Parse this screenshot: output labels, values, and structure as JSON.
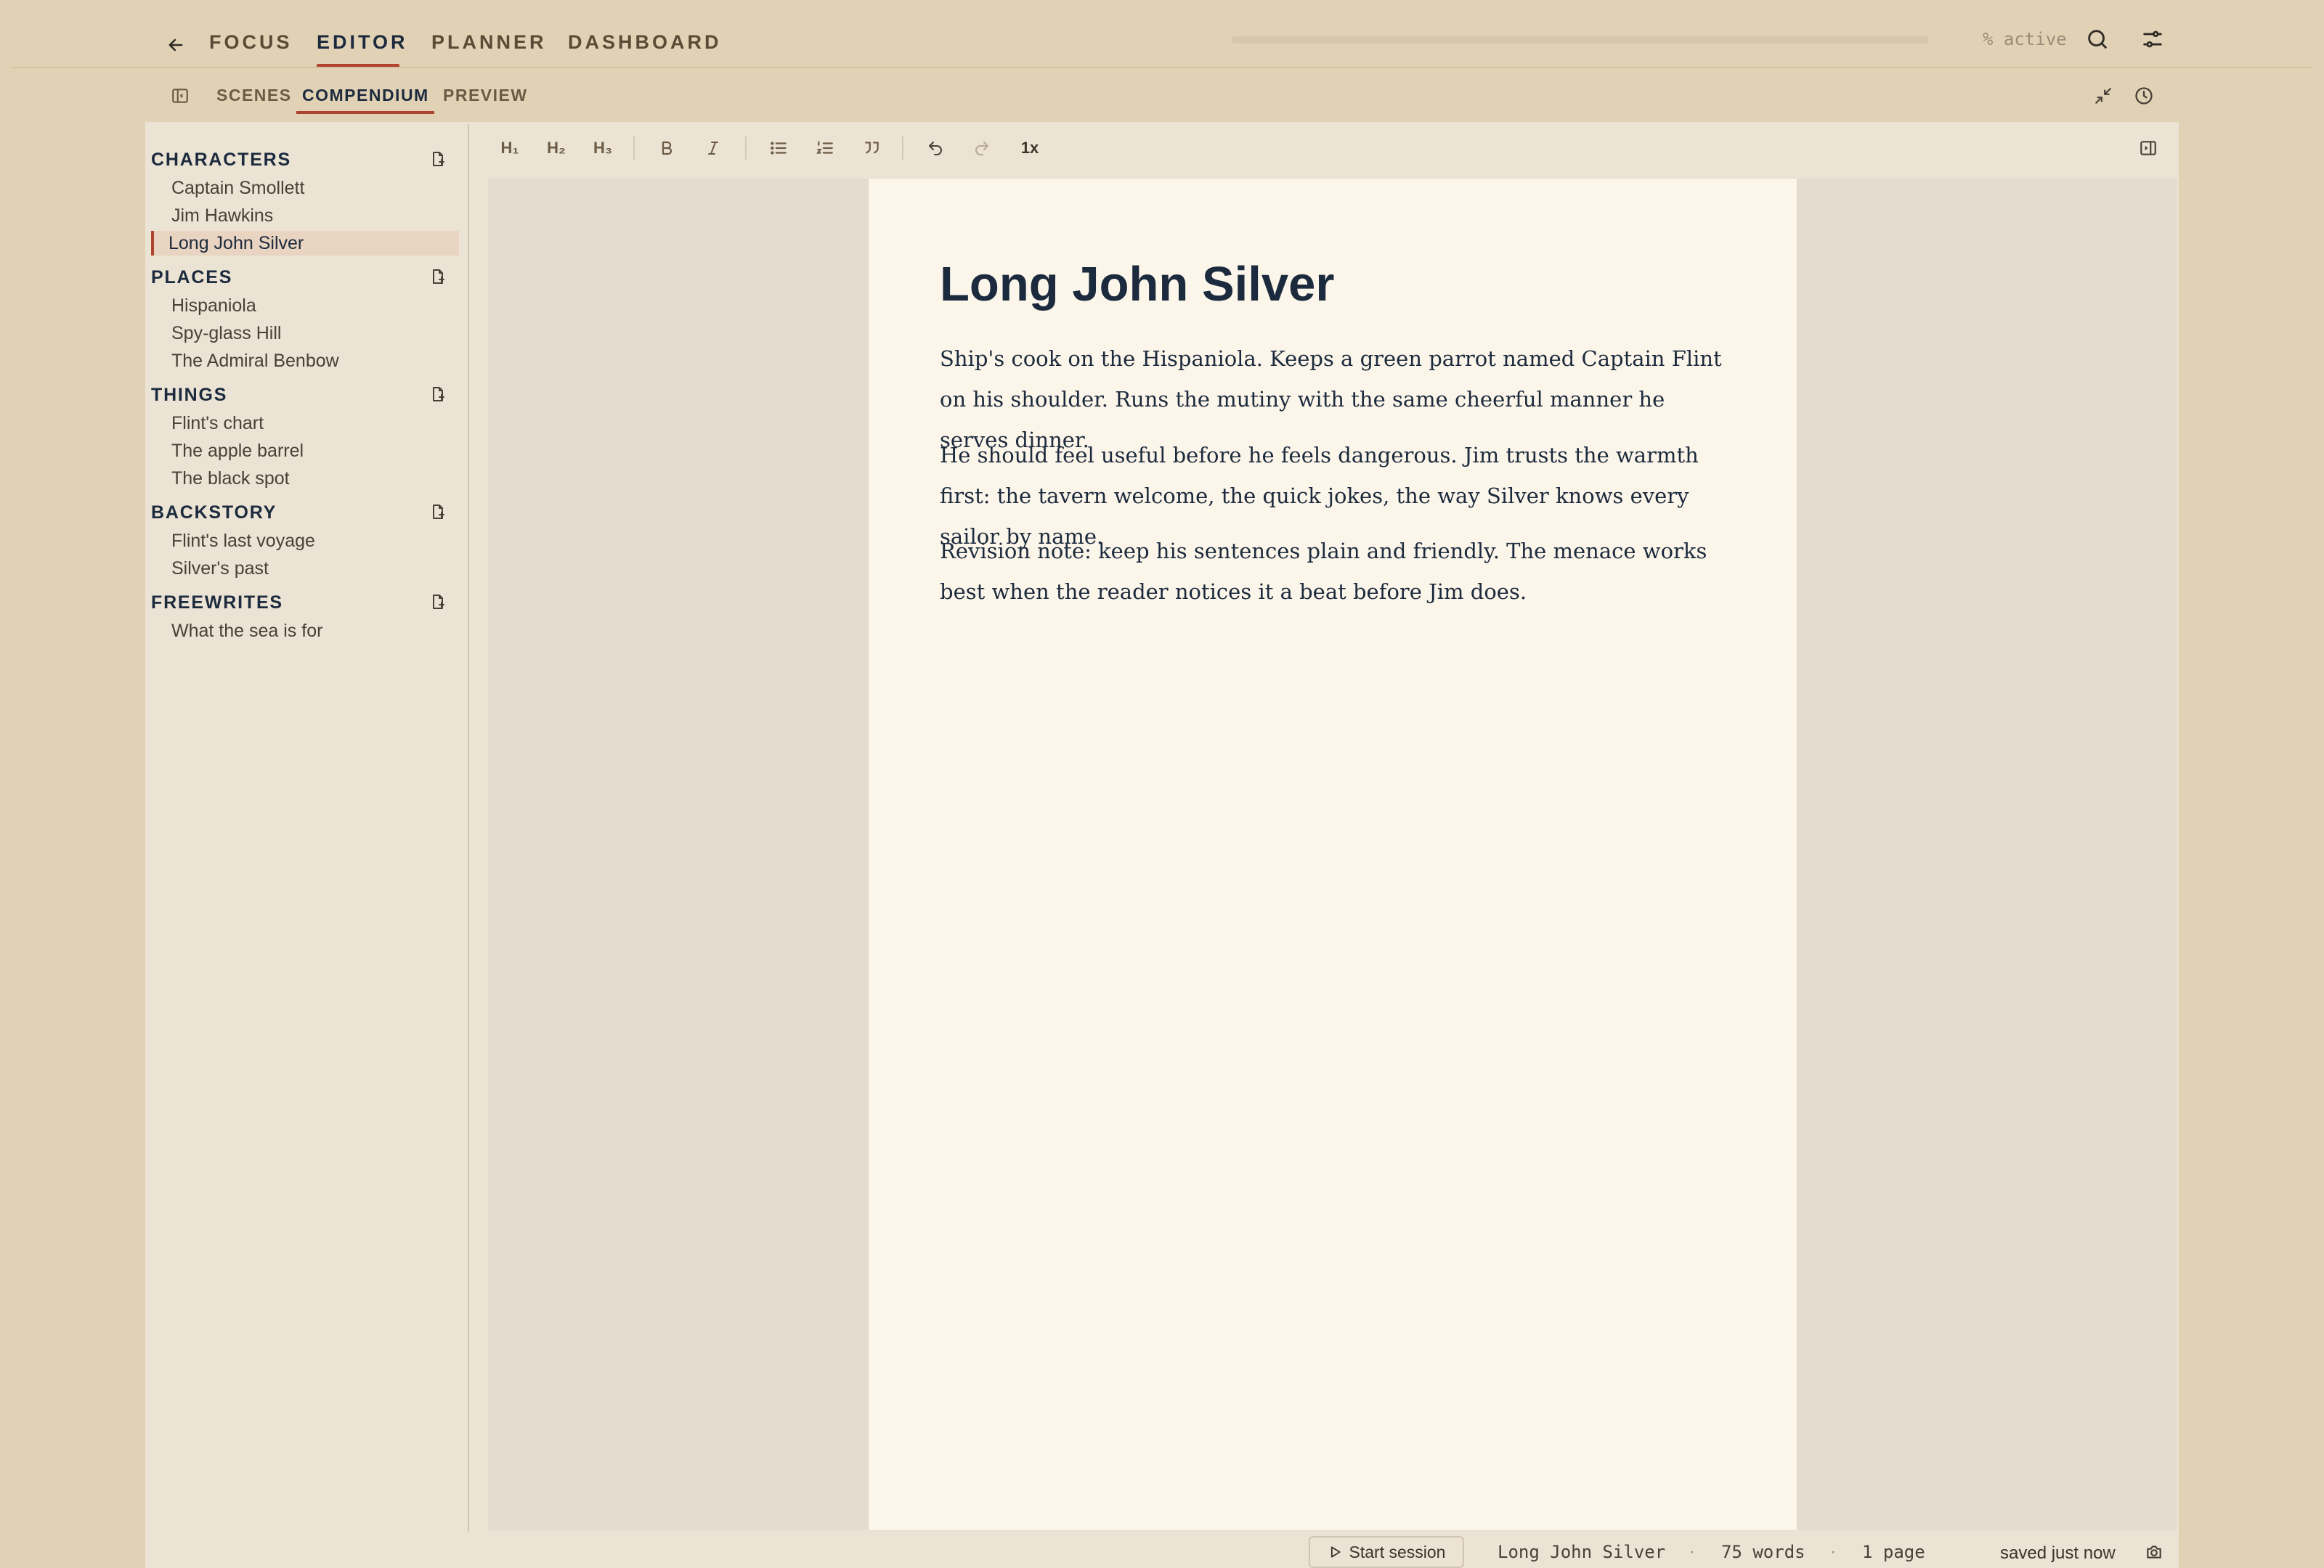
{
  "nav": {
    "tabs": [
      {
        "label": "FOCUS"
      },
      {
        "label": "EDITOR",
        "active": true
      },
      {
        "label": "PLANNER"
      },
      {
        "label": "DASHBOARD"
      }
    ],
    "active_label": "% active"
  },
  "subtabs": [
    {
      "label": "SCENES"
    },
    {
      "label": "COMPENDIUM",
      "active": true
    },
    {
      "label": "PREVIEW"
    }
  ],
  "sidebar": {
    "sections": [
      {
        "title": "CHARACTERS",
        "items": [
          "Captain Smollett",
          "Jim Hawkins",
          "Long John Silver"
        ]
      },
      {
        "title": "PLACES",
        "items": [
          "Hispaniola",
          "Spy-glass Hill",
          "The Admiral Benbow"
        ]
      },
      {
        "title": "THINGS",
        "items": [
          "Flint's chart",
          "The apple barrel",
          "The black spot"
        ]
      },
      {
        "title": "BACKSTORY",
        "items": [
          "Flint's last voyage",
          "Silver's past"
        ]
      },
      {
        "title": "FREEWRITES",
        "items": [
          "What the sea is for"
        ]
      }
    ],
    "selected_item": "Long John Silver"
  },
  "toolbar": {
    "h1": "H₁",
    "h2": "H₂",
    "h3": "H₃",
    "zoom": "1x"
  },
  "document": {
    "title": "Long John Silver",
    "paragraphs": [
      "Ship's cook on the Hispaniola. Keeps a green parrot named Captain Flint on his shoulder. Runs the mutiny with the same cheerful manner he serves dinner.",
      "He should feel useful before he feels dangerous. Jim trusts the warmth first: the tavern welcome, the quick jokes, the way Silver knows every sailor by name.",
      "Revision note: keep his sentences plain and friendly. The menace works best when the reader notices it a beat before Jim does."
    ]
  },
  "statusbar": {
    "session_button": "Start session",
    "doc_name": "Long John Silver",
    "separator": "·",
    "word_count": "75 words",
    "page_count": "1 page",
    "saved": "saved just now"
  },
  "colors": {
    "background": "#e2d2b5",
    "panel": "#ebe3d4",
    "page": "#fcf6ea",
    "accent": "#b0432e",
    "text": "#1c2a3d"
  },
  "icons": [
    "arrow-left-icon",
    "search-icon",
    "sliders-icon",
    "sidebar-toggle-icon",
    "minimize-icon",
    "clock-icon",
    "new-file-icon",
    "bold-icon",
    "italic-icon",
    "bullet-list-icon",
    "numbered-list-icon",
    "quote-icon",
    "undo-icon",
    "redo-icon",
    "panel-right-icon",
    "play-icon",
    "camera-icon"
  ]
}
